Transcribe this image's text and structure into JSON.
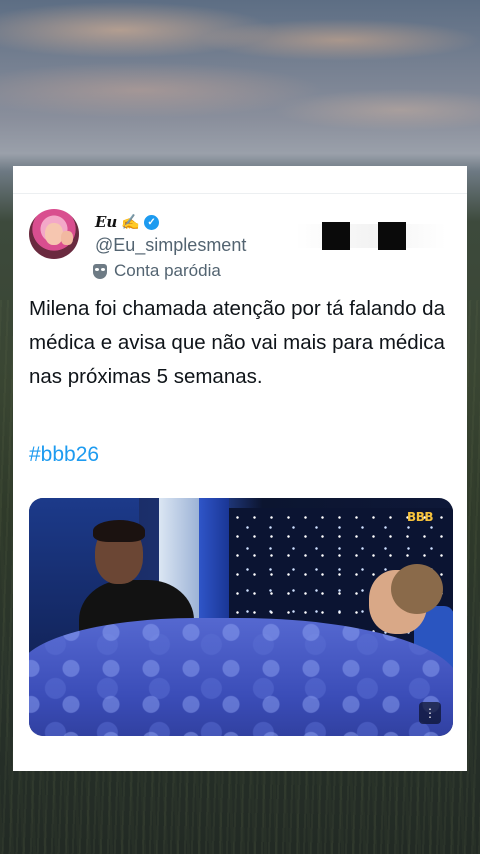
{
  "post": {
    "display_name": "Eu",
    "name_emoji": "✍",
    "handle": "@Eu_simplesment",
    "account_label": "Conta paródia",
    "text": "Milena foi chamada atenção por tá falando da médica e avisa que não vai mais para médica nas próximas 5 semanas.",
    "hashtag": "#bbb26"
  },
  "media": {
    "logo": "BBB",
    "more_glyph": "⋮"
  },
  "icons": {
    "verified": "verified-badge-icon",
    "parody": "theater-mask-icon"
  },
  "colors": {
    "link": "#1d9bf0",
    "verified": "#1d9bf0",
    "text": "#0f1419",
    "secondary": "#536471"
  }
}
